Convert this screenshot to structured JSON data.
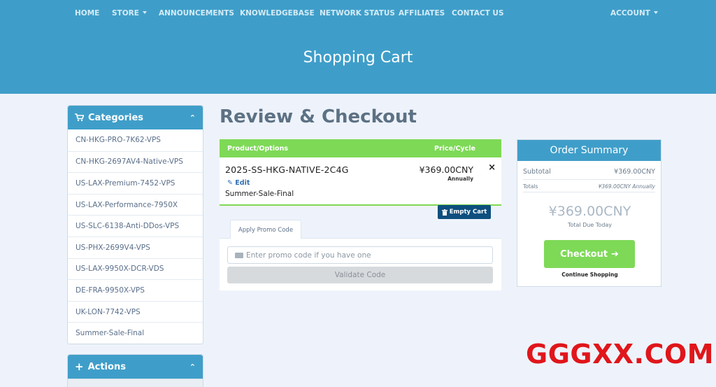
{
  "nav": {
    "home": "HOME",
    "store": "STORE",
    "announcements": "ANNOUNCEMENTS",
    "knowledgebase": "KNOWLEDGEBASE",
    "network_status": "NETWORK STATUS",
    "affiliates": "AFFILIATES",
    "contact_us": "CONTACT US",
    "account": "ACCOUNT"
  },
  "hero": {
    "title": "Shopping Cart"
  },
  "sidebar": {
    "categories": {
      "title": "Categories",
      "items": [
        "CN-HKG-PRO-7K62-VPS",
        "CN-HKG-2697AV4-Native-VPS",
        "US-LAX-Premium-7452-VPS",
        "US-LAX-Performance-7950X",
        "US-SLC-6138-Anti-DDos-VPS",
        "US-PHX-2699V4-VPS",
        "US-LAX-9950X-DCR-VDS",
        "DE-FRA-9950X-VPS",
        "UK-LON-7742-VPS",
        "Summer-Sale-Final"
      ]
    },
    "actions": {
      "title": "Actions"
    }
  },
  "main": {
    "title": "Review & Checkout",
    "cart": {
      "header_product": "Product/Options",
      "header_price": "Price/Cycle",
      "item": {
        "name": "2025-SS-HKG-NATIVE-2C4G",
        "edit": "Edit",
        "group": "Summer-Sale-Final",
        "price": "¥369.00CNY",
        "cycle": "Annually",
        "remove": "×"
      },
      "empty_cart": "Empty Cart"
    },
    "promo": {
      "tab": "Apply Promo Code",
      "placeholder": "Enter promo code if you have one",
      "validate": "Validate Code"
    }
  },
  "summary": {
    "title": "Order Summary",
    "subtotal_label": "Subtotal",
    "subtotal_value": "¥369.00CNY",
    "totals_label": "Totals",
    "totals_value": "¥369.00CNY Annually",
    "total_due": "¥369.00CNY",
    "total_due_label": "Total Due Today",
    "checkout": "Checkout",
    "continue": "Continue Shopping"
  },
  "watermark": "GGGXX.COM",
  "colors": {
    "primary": "#3f9ec9",
    "success": "#7ed957",
    "dark_blue": "#0d4f7e",
    "watermark": "#e0161b"
  }
}
